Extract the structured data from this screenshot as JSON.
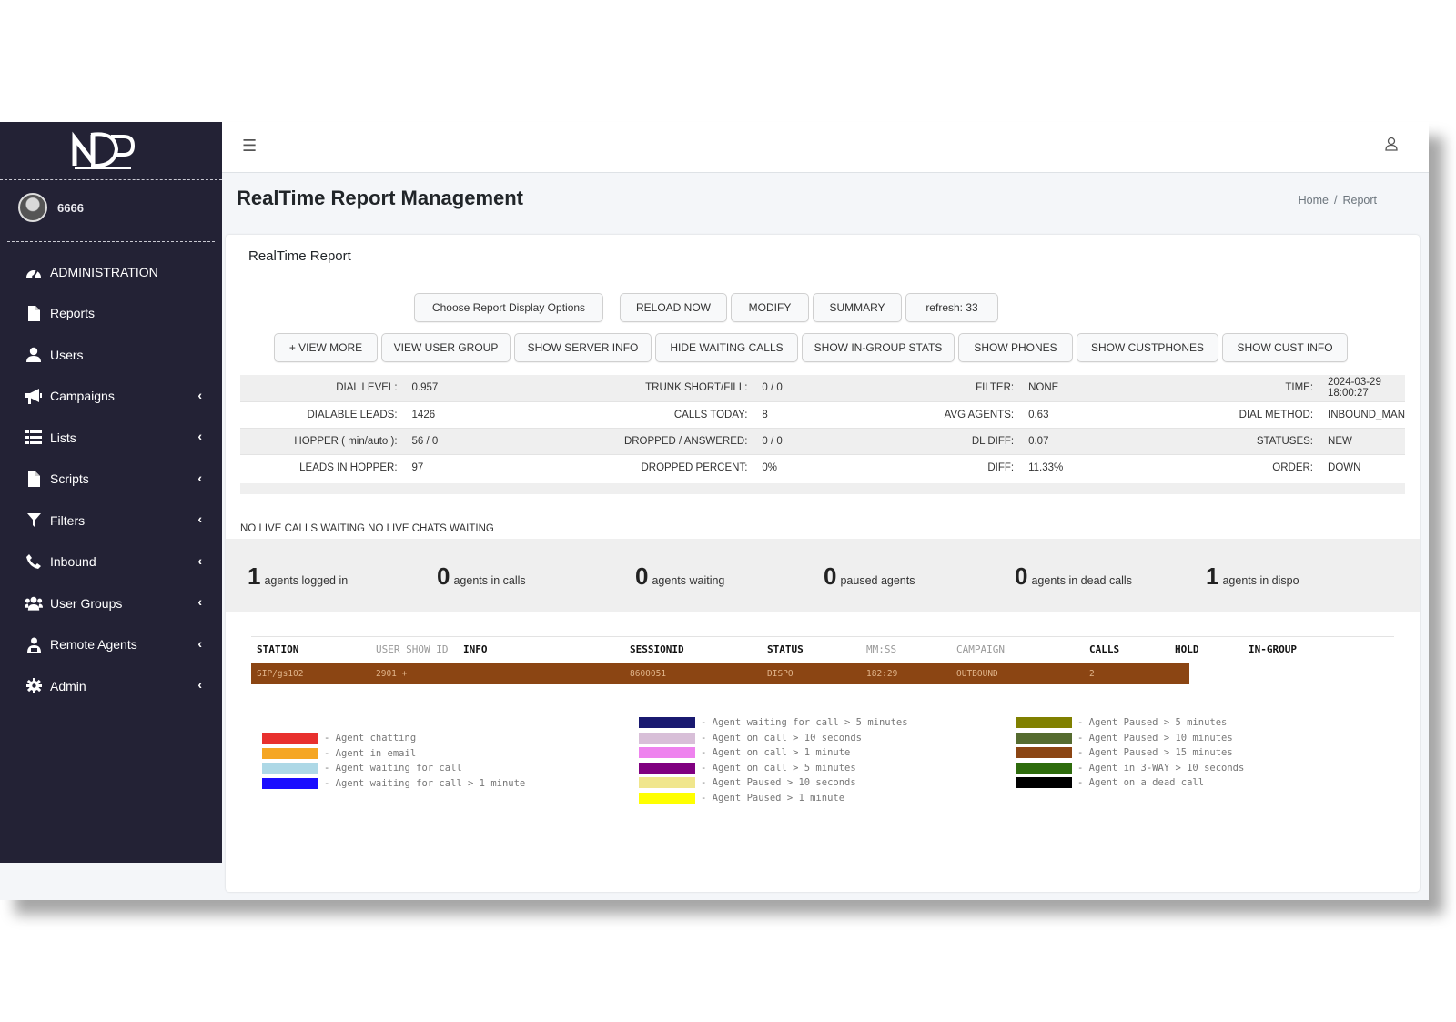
{
  "sidebar": {
    "user_name": "6666",
    "items": [
      {
        "label": "ADMINISTRATION",
        "icon": "dashboard-icon",
        "has_chevron": false
      },
      {
        "label": "Reports",
        "icon": "file-icon",
        "has_chevron": false
      },
      {
        "label": "Users",
        "icon": "user-icon",
        "has_chevron": false
      },
      {
        "label": "Campaigns",
        "icon": "megaphone-icon",
        "has_chevron": true
      },
      {
        "label": "Lists",
        "icon": "list-icon",
        "has_chevron": true
      },
      {
        "label": "Scripts",
        "icon": "file-icon",
        "has_chevron": true
      },
      {
        "label": "Filters",
        "icon": "filter-icon",
        "has_chevron": true
      },
      {
        "label": "Inbound",
        "icon": "phone-icon",
        "has_chevron": true
      },
      {
        "label": "User Groups",
        "icon": "users-icon",
        "has_chevron": true
      },
      {
        "label": "Remote Agents",
        "icon": "remote-agent-icon",
        "has_chevron": true
      },
      {
        "label": "Admin",
        "icon": "gear-icon",
        "has_chevron": true
      }
    ]
  },
  "header": {
    "title": "RealTime Report Management",
    "breadcrumb": {
      "home": "Home",
      "separator": "/",
      "current": "Report"
    }
  },
  "card": {
    "title": "RealTime Report",
    "buttons_row1": [
      "Choose Report Display Options",
      "RELOAD NOW",
      "MODIFY",
      "SUMMARY",
      "refresh: 33"
    ],
    "buttons_row2": [
      "+ VIEW MORE",
      "VIEW USER GROUP",
      "SHOW SERVER INFO",
      "HIDE WAITING CALLS",
      "SHOW IN-GROUP STATS",
      "SHOW PHONES",
      "SHOW CUSTPHONES",
      "SHOW CUST INFO"
    ],
    "stats": [
      [
        [
          "DIAL LEVEL:",
          "0.957"
        ],
        [
          "TRUNK SHORT/FILL:",
          "0 / 0"
        ],
        [
          "FILTER:",
          "NONE"
        ],
        [
          "TIME:",
          "2024-03-29 18:00:27"
        ]
      ],
      [
        [
          "DIALABLE LEADS:",
          "1426"
        ],
        [
          "CALLS TODAY:",
          "8"
        ],
        [
          "AVG AGENTS:",
          "0.63"
        ],
        [
          "DIAL METHOD:",
          "INBOUND_MAN"
        ]
      ],
      [
        [
          "HOPPER ( min/auto ):",
          "56 / 0"
        ],
        [
          "DROPPED / ANSWERED:",
          "0 / 0"
        ],
        [
          "DL DIFF:",
          "0.07"
        ],
        [
          "STATUSES:",
          "NEW"
        ]
      ],
      [
        [
          "LEADS IN HOPPER:",
          "97"
        ],
        [
          "DROPPED PERCENT:",
          "0%"
        ],
        [
          "DIFF:",
          "11.33%"
        ],
        [
          "ORDER:",
          "DOWN"
        ]
      ]
    ],
    "live_status": "NO LIVE CALLS WAITING NO LIVE CHATS WAITING",
    "summary": [
      {
        "num": "1",
        "label": "agents logged in"
      },
      {
        "num": "0",
        "label": "agents in calls"
      },
      {
        "num": "0",
        "label": "agents waiting"
      },
      {
        "num": "0",
        "label": "paused agents"
      },
      {
        "num": "0",
        "label": "agents in dead calls"
      },
      {
        "num": "1",
        "label": "agents in dispo"
      }
    ],
    "agent_table": {
      "headers": [
        "STATION",
        "USER SHOW ID",
        "INFO",
        "SESSIONID",
        "STATUS",
        "MM:SS",
        "CAMPAIGN",
        "CALLS",
        "HOLD",
        "IN-GROUP"
      ],
      "rows": [
        {
          "station": "SIP/gs102",
          "user": "2901 +",
          "sessionid": "8600051",
          "status": "DISPO",
          "mmss": "182:29",
          "campaign": "OUTBOUND",
          "calls": "2",
          "color": "#8b4513"
        }
      ]
    },
    "legend": [
      [
        {
          "color": "#e8302e",
          "label": "- Agent chatting"
        },
        {
          "color": "#f5a623",
          "label": "- Agent in email"
        },
        {
          "color": "#add8e6",
          "label": "- Agent waiting for call"
        },
        {
          "color": "#1a0dff",
          "label": "- Agent waiting for call > 1 minute"
        }
      ],
      [
        {
          "color": "#191970",
          "label": "- Agent waiting for call > 5 minutes"
        },
        {
          "color": "#d8bfd8",
          "label": "- Agent on call > 10 seconds"
        },
        {
          "color": "#ee82ee",
          "label": "- Agent on call > 1 minute"
        },
        {
          "color": "#800080",
          "label": "- Agent on call > 5 minutes"
        },
        {
          "color": "#f0e68c",
          "label": "- Agent Paused > 10 seconds"
        },
        {
          "color": "#ffff00",
          "label": "- Agent Paused > 1 minute"
        }
      ],
      [
        {
          "color": "#808000",
          "label": "- Agent Paused > 5 minutes"
        },
        {
          "color": "#556b2f",
          "label": "- Agent Paused > 10 minutes"
        },
        {
          "color": "#8b4513",
          "label": "- Agent Paused > 15 minutes"
        },
        {
          "color": "#2e6b0c",
          "label": "- Agent in 3-WAY > 10 seconds"
        },
        {
          "color": "#000000",
          "label": "- Agent on a dead call"
        }
      ]
    ]
  }
}
